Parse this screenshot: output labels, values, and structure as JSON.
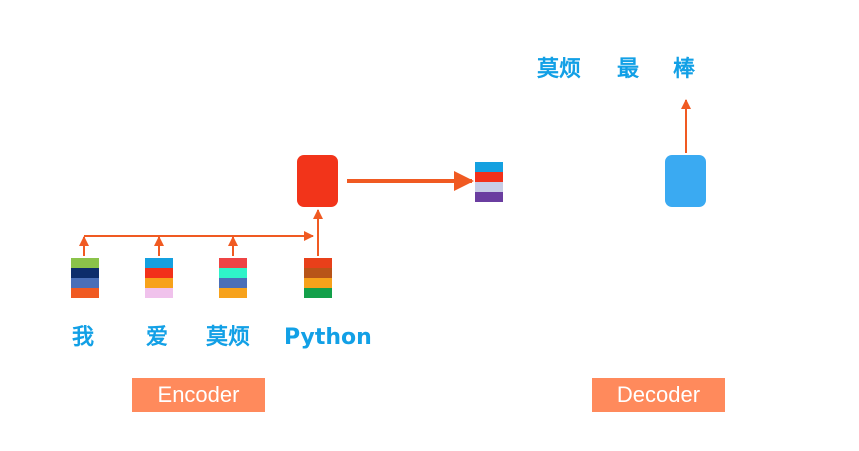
{
  "input_tokens": [
    {
      "label": "我",
      "colors": [
        "#8bc34a",
        "#0d2d6b",
        "#4a6fb8",
        "#f05a22"
      ]
    },
    {
      "label": "爱",
      "colors": [
        "#14a0e0",
        "#f2311a",
        "#f7a21b",
        "#f0c2ec"
      ]
    },
    {
      "label": "莫烦",
      "colors": [
        "#ee4445",
        "#2ff3c9",
        "#4a6fb8",
        "#f7a21b"
      ]
    },
    {
      "label": "Python",
      "colors": [
        "#e8401a",
        "#b85418",
        "#f7a21b",
        "#13a04a"
      ]
    }
  ],
  "context_vector": {
    "colors": [
      "#14a0e0",
      "#f2311a",
      "#c8cde6",
      "#6a3da0"
    ]
  },
  "output_tokens": [
    "莫烦",
    "最",
    "棒"
  ],
  "encoder": {
    "label": "Encoder",
    "color": "#f2341a"
  },
  "decoder": {
    "label": "Decoder",
    "color": "#3aaaf2"
  },
  "colors": {
    "text": "#12a0e6",
    "arrow": "#f05a22",
    "tag_bg": "#ff8a5c"
  }
}
